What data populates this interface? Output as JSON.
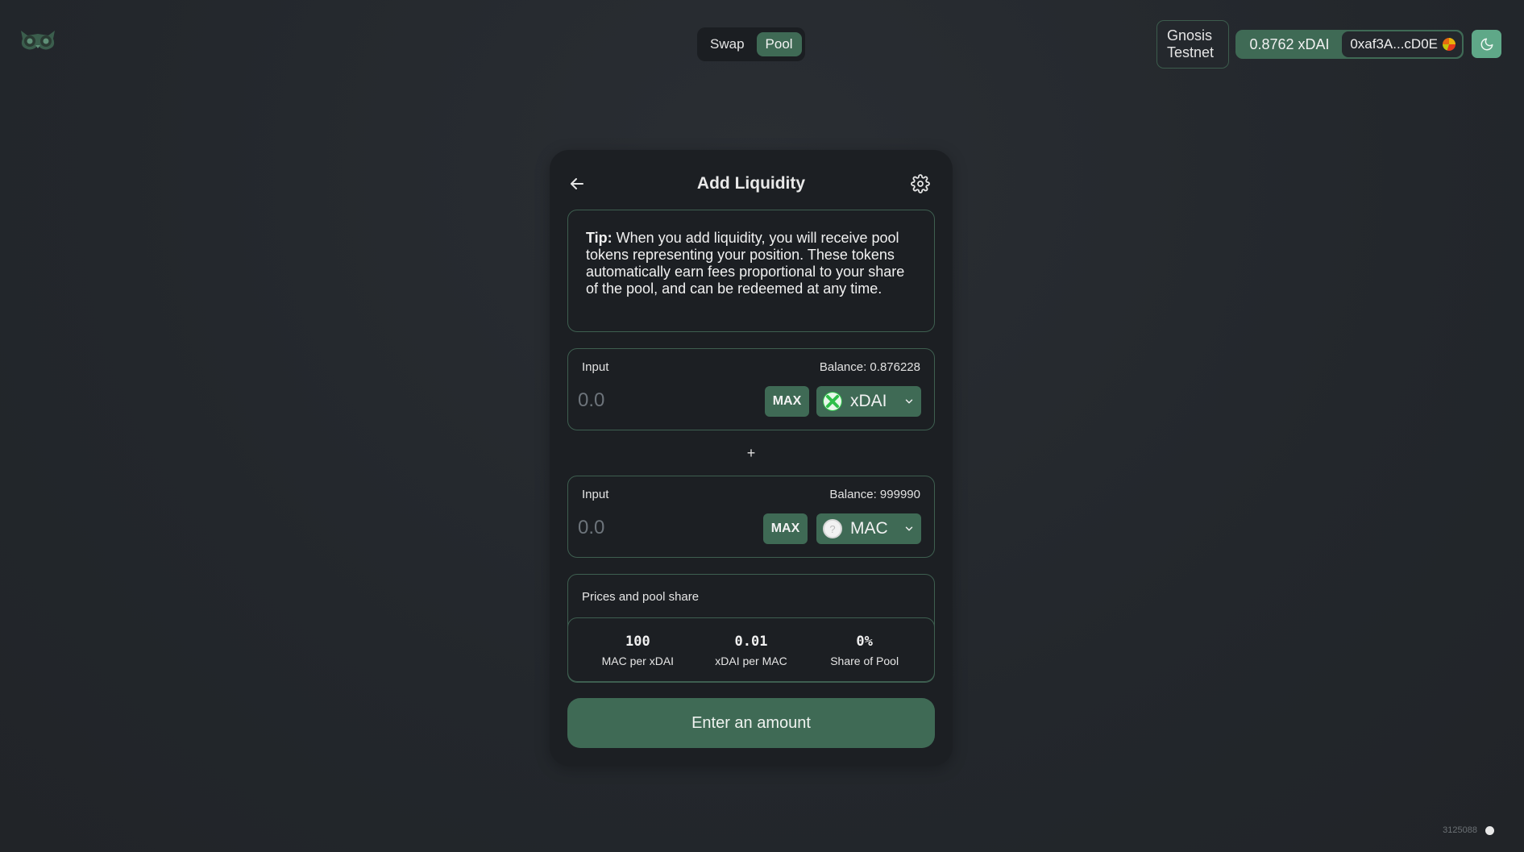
{
  "header": {
    "nav": {
      "swap_label": "Swap",
      "pool_label": "Pool"
    },
    "network_line1": "Gnosis",
    "network_line2": "Testnet",
    "account_balance": "0.8762 xDAI",
    "account_address": "0xaf3A...cD0E",
    "theme_icon": "moon-icon"
  },
  "card": {
    "title": "Add Liquidity",
    "tip_bold": "Tip:",
    "tip_text": " When you add liquidity, you will receive pool tokens representing your position. These tokens automatically earn fees proportional to your share of the pool, and can be redeemed at any time.",
    "input_a": {
      "label": "Input",
      "balance": "Balance: 0.876228",
      "placeholder": "0.0",
      "max_label": "MAX",
      "token": "xDAI"
    },
    "plus": "+",
    "input_b": {
      "label": "Input",
      "balance": "Balance: 999990",
      "placeholder": "0.0",
      "max_label": "MAX",
      "token": "MAC"
    },
    "prices": {
      "title": "Prices and pool share",
      "items": [
        {
          "value": "100",
          "label": "MAC per xDAI"
        },
        {
          "value": "0.01",
          "label": "xDAI per MAC"
        },
        {
          "value": "0%",
          "label": "Share of Pool"
        }
      ]
    },
    "submit_label": "Enter an amount"
  },
  "footer": {
    "block_number": "3125088"
  },
  "colors": {
    "accent": "#3f6a55",
    "accent_light": "#5fa888",
    "background": "#23272c",
    "card": "#1c1f23",
    "border": "#3e5f50"
  }
}
